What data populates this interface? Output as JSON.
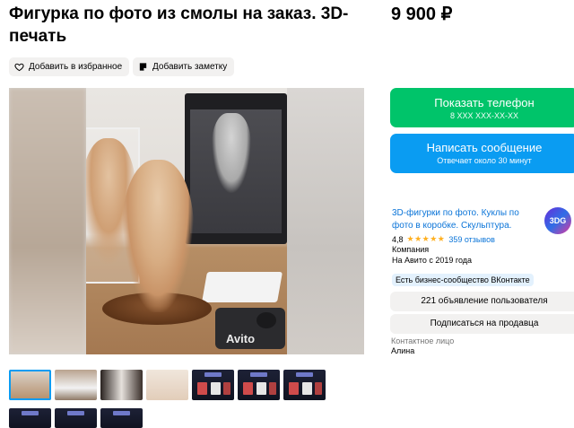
{
  "title": "Фигурка по фото из смолы на заказ. 3D-печать",
  "price": "9 900 ₽",
  "actions": {
    "favorite": "Добавить в избранное",
    "note": "Добавить заметку"
  },
  "gallery": {
    "watermark": "Avito"
  },
  "buttons": {
    "phone_label": "Показать телефон",
    "phone_sub": "8 XXX XXX-XX-XX",
    "message_label": "Написать сообщение",
    "message_sub": "Отвечает около 30 минут"
  },
  "seller": {
    "name": "3D-фигурки по фото. Куклы по фото в коробке. Скульптура.",
    "logo_text": "3DG",
    "rating": "4,8",
    "stars": "★★★★★",
    "reviews": "359 отзывов",
    "type": "Компания",
    "since": "На Авито с 2019 года",
    "badge": "Есть бизнес-сообщество ВКонтакте",
    "listings_button": "221 объявление пользователя",
    "subscribe_button": "Подписаться на продавца",
    "contact_label": "Контактное лицо",
    "contact_name": "Алина"
  },
  "colors": {
    "green": "#00c46a",
    "blue": "#0a9cf2",
    "link": "#0a74d8",
    "star": "#ffb021"
  }
}
